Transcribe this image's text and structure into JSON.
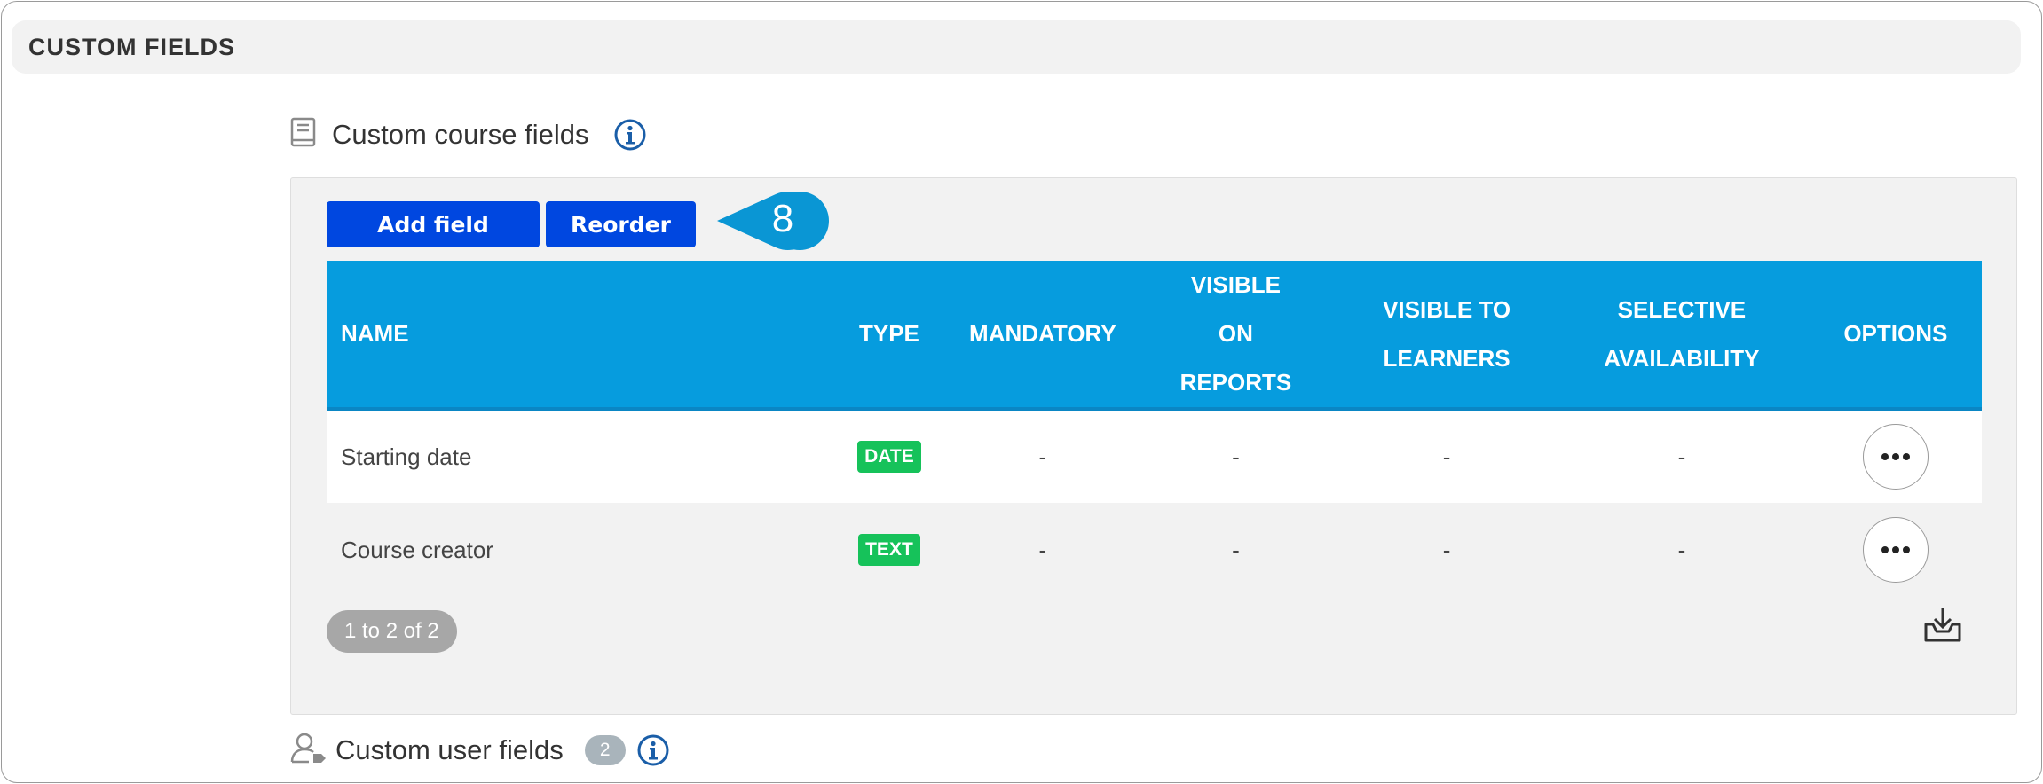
{
  "section": {
    "title": "CUSTOM FIELDS"
  },
  "course_fields": {
    "label": "Custom course fields",
    "add_button": "Add field",
    "reorder_button": "Reorder",
    "callout": "8",
    "columns": [
      "NAME",
      "TYPE",
      "MANDATORY",
      "VISIBLE ON REPORTS",
      "VISIBLE TO LEARNERS",
      "SELECTIVE AVAILABILITY",
      "OPTIONS"
    ],
    "rows": [
      {
        "name": "Starting date",
        "type": "DATE",
        "mandatory": "-",
        "visible_on_reports": "-",
        "visible_to_learners": "-",
        "selective_availability": "-"
      },
      {
        "name": "Course creator",
        "type": "TEXT",
        "mandatory": "-",
        "visible_on_reports": "-",
        "visible_to_learners": "-",
        "selective_availability": "-"
      }
    ],
    "pagination": "1 to 2 of 2"
  },
  "user_fields": {
    "label": "Custom user fields",
    "count": "2"
  },
  "icons": {
    "course": "book-icon",
    "info": "info-icon",
    "options": "more-horizontal-icon",
    "download": "download-tray-icon",
    "user": "user-tag-icon"
  },
  "colors": {
    "primary_button": "#0047e0",
    "table_header": "#069cde",
    "badge": "#16c25a",
    "info_icon": "#1a5ea8"
  }
}
